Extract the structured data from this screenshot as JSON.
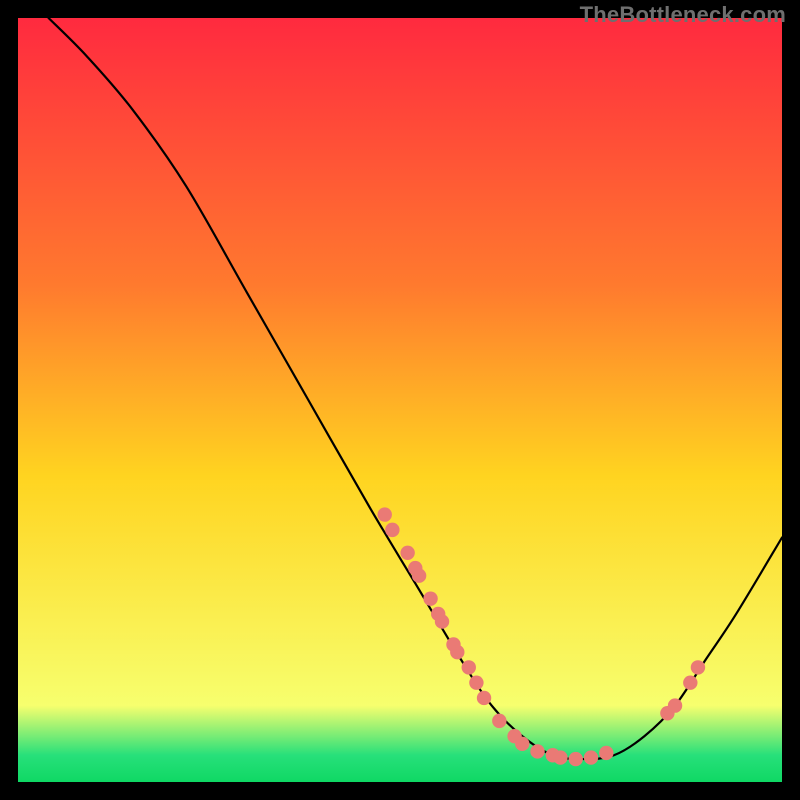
{
  "attribution": "TheBottleneck.com",
  "colors": {
    "background": "#000000",
    "curve": "#000000",
    "dots": "#ea7a75",
    "gradient_top": "#ff2a3f",
    "gradient_mid_upper": "#ff7a2e",
    "gradient_mid": "#ffd420",
    "gradient_lower": "#f7ff6e",
    "gradient_green": "#27e07a",
    "gradient_bottom": "#0fd864"
  },
  "chart_data": {
    "type": "line",
    "title": "",
    "xlabel": "",
    "ylabel": "",
    "xlim": [
      0,
      100
    ],
    "ylim": [
      0,
      100
    ],
    "curve": [
      {
        "x": 4,
        "y": 100
      },
      {
        "x": 9,
        "y": 95
      },
      {
        "x": 15,
        "y": 88
      },
      {
        "x": 22,
        "y": 78
      },
      {
        "x": 30,
        "y": 64
      },
      {
        "x": 38,
        "y": 50
      },
      {
        "x": 46,
        "y": 36
      },
      {
        "x": 52,
        "y": 26
      },
      {
        "x": 58,
        "y": 16
      },
      {
        "x": 62,
        "y": 10
      },
      {
        "x": 66,
        "y": 6
      },
      {
        "x": 70,
        "y": 3.5
      },
      {
        "x": 74,
        "y": 3
      },
      {
        "x": 78,
        "y": 3.5
      },
      {
        "x": 82,
        "y": 6
      },
      {
        "x": 86,
        "y": 10
      },
      {
        "x": 90,
        "y": 16
      },
      {
        "x": 94,
        "y": 22
      },
      {
        "x": 100,
        "y": 32
      }
    ],
    "points": [
      {
        "x": 48,
        "y": 35
      },
      {
        "x": 49,
        "y": 33
      },
      {
        "x": 51,
        "y": 30
      },
      {
        "x": 52,
        "y": 28
      },
      {
        "x": 52.5,
        "y": 27
      },
      {
        "x": 54,
        "y": 24
      },
      {
        "x": 55,
        "y": 22
      },
      {
        "x": 55.5,
        "y": 21
      },
      {
        "x": 57,
        "y": 18
      },
      {
        "x": 57.5,
        "y": 17
      },
      {
        "x": 59,
        "y": 15
      },
      {
        "x": 60,
        "y": 13
      },
      {
        "x": 61,
        "y": 11
      },
      {
        "x": 63,
        "y": 8
      },
      {
        "x": 65,
        "y": 6
      },
      {
        "x": 66,
        "y": 5
      },
      {
        "x": 68,
        "y": 4
      },
      {
        "x": 70,
        "y": 3.5
      },
      {
        "x": 71,
        "y": 3.2
      },
      {
        "x": 73,
        "y": 3
      },
      {
        "x": 75,
        "y": 3.2
      },
      {
        "x": 77,
        "y": 3.8
      },
      {
        "x": 85,
        "y": 9
      },
      {
        "x": 86,
        "y": 10
      },
      {
        "x": 88,
        "y": 13
      },
      {
        "x": 89,
        "y": 15
      }
    ]
  }
}
